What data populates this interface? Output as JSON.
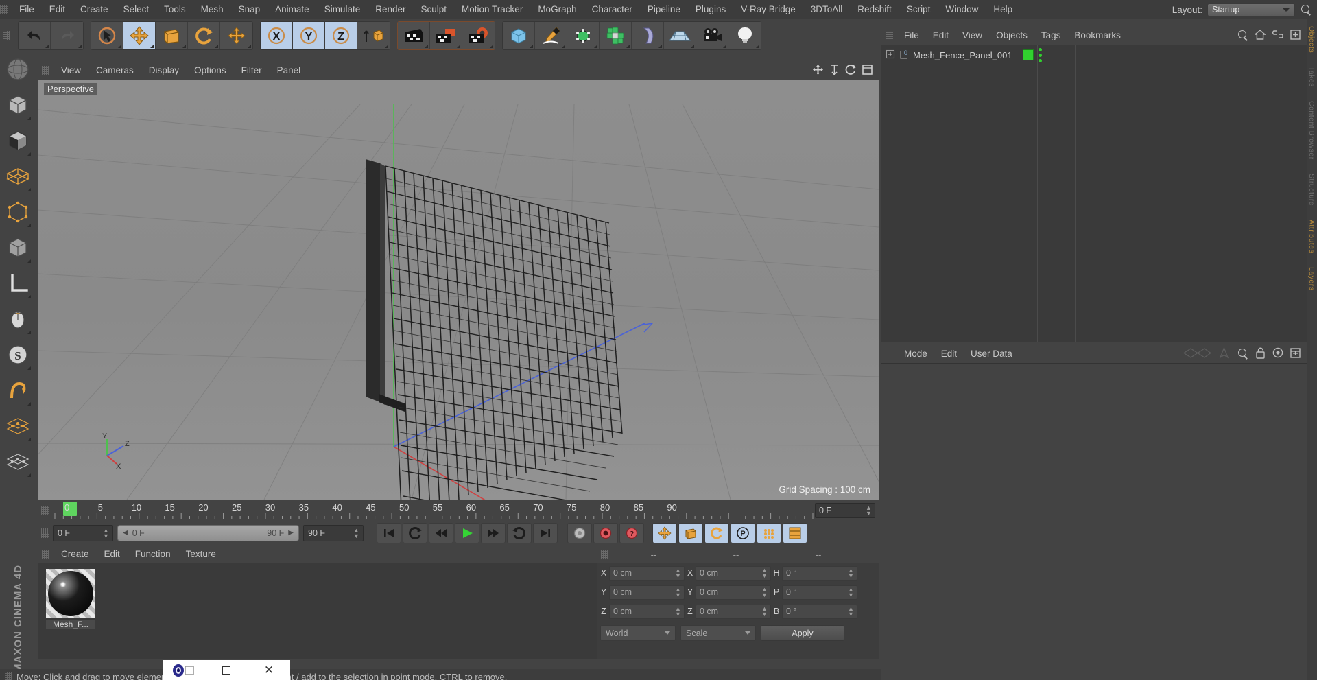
{
  "app": {
    "brand": "MAXON CINEMA 4D"
  },
  "top_menu": {
    "items": [
      "File",
      "Edit",
      "Create",
      "Select",
      "Tools",
      "Mesh",
      "Snap",
      "Animate",
      "Simulate",
      "Render",
      "Sculpt",
      "Motion Tracker",
      "MoGraph",
      "Character",
      "Pipeline",
      "Plugins",
      "V-Ray Bridge",
      "3DToAll",
      "Redshift",
      "Script",
      "Window",
      "Help"
    ],
    "layout_label": "Layout:",
    "layout_value": "Startup",
    "search_icon": "search-icon"
  },
  "toolbar": {
    "groups": [
      {
        "name": "history",
        "buttons": [
          {
            "icon": "undo-icon",
            "active": false
          },
          {
            "icon": "redo-icon",
            "active": false
          }
        ]
      },
      {
        "name": "transform",
        "buttons": [
          {
            "icon": "select-live-icon",
            "active": false
          },
          {
            "icon": "move-icon",
            "active": true
          },
          {
            "icon": "scale-icon",
            "active": false
          },
          {
            "icon": "rotate-icon",
            "active": false
          },
          {
            "icon": "move-alt-icon",
            "active": false
          }
        ]
      },
      {
        "name": "axis-locks",
        "buttons": [
          {
            "icon": "axis-x-icon",
            "active": true
          },
          {
            "icon": "axis-y-icon",
            "active": true
          },
          {
            "icon": "axis-z-icon",
            "active": true
          },
          {
            "icon": "world-object-axis-icon",
            "active": false
          }
        ]
      },
      {
        "name": "render",
        "buttons": [
          {
            "icon": "render-view-icon",
            "active": false
          },
          {
            "icon": "render-to-picture-viewer-icon",
            "active": false
          },
          {
            "icon": "render-settings-icon",
            "active": false
          }
        ]
      },
      {
        "name": "create-objects",
        "buttons": [
          {
            "icon": "cube-primitive-icon",
            "active": false
          },
          {
            "icon": "spline-pen-icon",
            "active": false
          },
          {
            "icon": "nurbs-icon",
            "active": false
          },
          {
            "icon": "array-icon",
            "active": false
          },
          {
            "icon": "deformer-icon",
            "active": false
          },
          {
            "icon": "floor-environment-icon",
            "active": false
          },
          {
            "icon": "camera-icon",
            "active": false
          },
          {
            "icon": "light-icon",
            "active": false
          }
        ]
      }
    ]
  },
  "left_palette": {
    "items": [
      {
        "icon": "model-undo-view-icon"
      },
      {
        "icon": "model-mode-icon"
      },
      {
        "icon": "texture-mode-icon"
      },
      {
        "icon": "polygon-mode-icon"
      },
      {
        "icon": "point-mode-icon"
      },
      {
        "icon": "edge-mode-icon"
      },
      {
        "icon": "object-axis-mode-icon"
      },
      {
        "icon": "workplane-icon"
      },
      {
        "icon": "enable-axis-icon"
      },
      {
        "icon": "soft-selection-icon"
      },
      {
        "icon": "snap-icon"
      },
      {
        "icon": "quantize-icon"
      },
      {
        "icon": "workplane-lock-icon"
      }
    ]
  },
  "viewport": {
    "menu": [
      "View",
      "Cameras",
      "Display",
      "Options",
      "Filter",
      "Panel"
    ],
    "view_label": "Perspective",
    "grid_spacing": "Grid Spacing : 100 cm",
    "axis_labels": {
      "x": "X",
      "y": "Y",
      "z": "Z"
    },
    "corner_icons": [
      "move-view-icon",
      "scale-view-icon",
      "rotate-view-icon",
      "maximize-view-icon"
    ]
  },
  "timeline": {
    "marker_frame": "0",
    "ticks": [
      "0",
      "5",
      "10",
      "15",
      "20",
      "25",
      "30",
      "35",
      "40",
      "45",
      "50",
      "55",
      "60",
      "65",
      "70",
      "75",
      "80",
      "85",
      "90"
    ],
    "current_frame_field": "0 F"
  },
  "transport": {
    "start_field": "0 F",
    "range_start": "0 F",
    "range_end": "90 F",
    "end_field": "90 F",
    "buttons": [
      {
        "icon": "go-to-start-icon",
        "active": false
      },
      {
        "icon": "play-reverse-loop-icon",
        "active": false
      },
      {
        "icon": "step-back-icon",
        "active": false
      },
      {
        "icon": "play-icon",
        "active": false
      },
      {
        "icon": "step-forward-icon",
        "active": false
      },
      {
        "icon": "loop-icon",
        "active": false
      },
      {
        "icon": "go-to-end-icon",
        "active": false
      },
      {
        "icon": "record-keyframe-icon",
        "active": false
      },
      {
        "icon": "autokey-icon",
        "active": false
      },
      {
        "icon": "keyframe-selection-icon",
        "active": false
      },
      {
        "icon": "position-key-icon",
        "active": true
      },
      {
        "icon": "scale-key-icon",
        "active": true
      },
      {
        "icon": "rotation-key-icon",
        "active": true
      },
      {
        "icon": "param-key-icon",
        "active": true
      },
      {
        "icon": "point-level-anim-icon",
        "active": true
      },
      {
        "icon": "timeline-layout-icon",
        "active": true
      }
    ]
  },
  "material_manager": {
    "menu": [
      "Create",
      "Edit",
      "Function",
      "Texture"
    ],
    "materials": [
      {
        "name": "Mesh_F..."
      }
    ]
  },
  "coordinates": {
    "headers": [
      "--",
      "--",
      "--"
    ],
    "rows": [
      {
        "label_pos": "X",
        "pos": "0 cm",
        "label_size": "X",
        "size": "0 cm",
        "label_rot": "H",
        "rot": "0 °"
      },
      {
        "label_pos": "Y",
        "pos": "0 cm",
        "label_size": "Y",
        "size": "0 cm",
        "label_rot": "P",
        "rot": "0 °"
      },
      {
        "label_pos": "Z",
        "pos": "0 cm",
        "label_size": "Z",
        "size": "0 cm",
        "label_rot": "B",
        "rot": "0 °"
      }
    ],
    "coord_system": "World",
    "transform_mode": "Scale",
    "apply_label": "Apply"
  },
  "object_manager": {
    "menu": [
      "File",
      "Edit",
      "View",
      "Objects",
      "Tags",
      "Bookmarks"
    ],
    "icons": [
      "search-icon",
      "home-icon",
      "link-icon",
      "expand-icon"
    ],
    "objects": [
      {
        "name": "Mesh_Fence_Panel_001",
        "layer": "0",
        "tag": "material-tag"
      }
    ]
  },
  "attributes": {
    "menu": [
      "Mode",
      "Edit",
      "User Data"
    ],
    "icons": [
      "history-back-icon",
      "pin-icon",
      "search-icon",
      "lock-icon",
      "target-icon",
      "expand-icon"
    ]
  },
  "right_tabs": [
    "Objects",
    "Takes",
    "Content Browser",
    "Structure",
    "Attributes",
    "Layers"
  ],
  "status_bar": {
    "text": "Move: Click and drag to move elements, SHIFT to quantize movement / add to the selection in point mode, CTRL to remove."
  },
  "taskbar_window": {
    "icons": [
      "app-icon",
      "restore-icon",
      "maximize-icon",
      "close-icon"
    ],
    "close_glyph": "✕"
  },
  "colors": {
    "accent_blue": "#b9cee8",
    "green_tag": "#31d12f",
    "orange": "#e8a33d",
    "panel_bg": "#434343",
    "dark_bg": "#3a3a3a"
  }
}
